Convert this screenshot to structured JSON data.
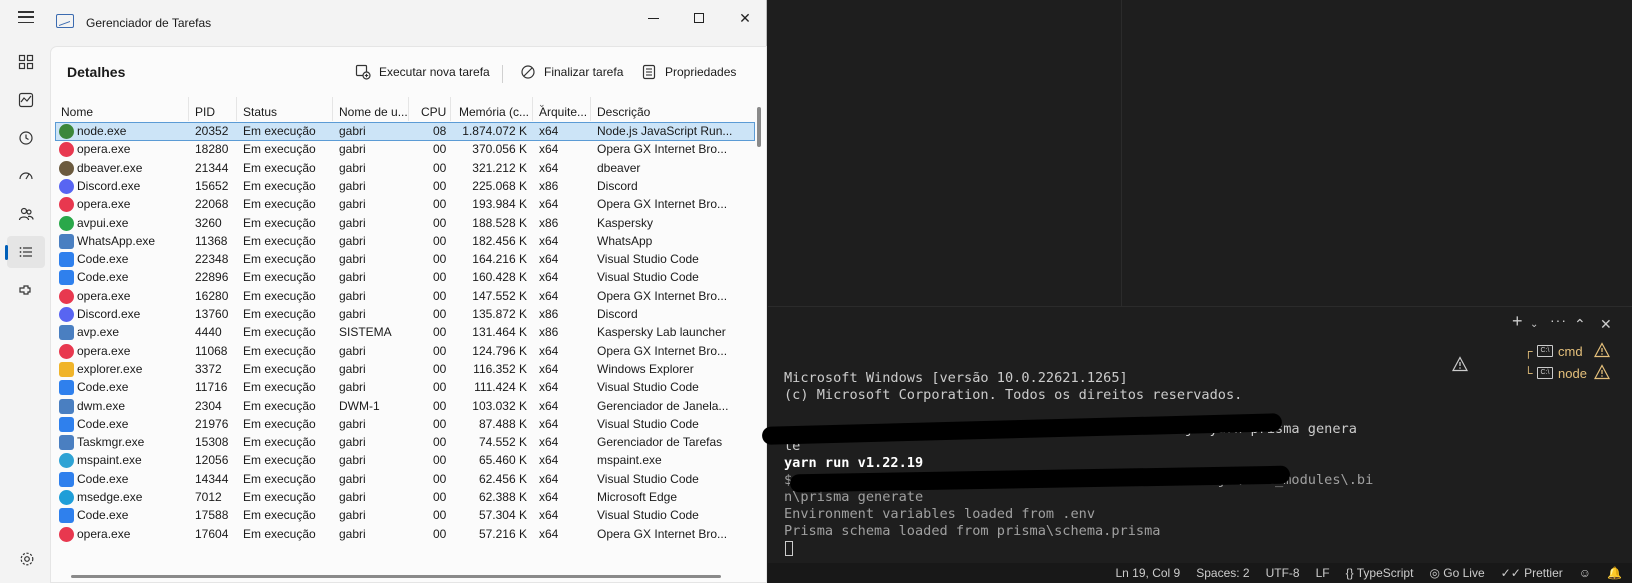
{
  "window": {
    "title": "Gerenciador de Tarefas",
    "minimize": "—",
    "maximize": "☐",
    "close": "✕"
  },
  "nav": {
    "items": [
      "processes-icon",
      "performance-icon",
      "app-history-icon",
      "startup-icon",
      "users-icon",
      "details-icon",
      "services-icon"
    ],
    "active": "details-icon"
  },
  "header": {
    "title": "Detalhes",
    "run_new_task": "Executar nova tarefa",
    "end_task": "Finalizar tarefa",
    "properties": "Propriedades"
  },
  "table": {
    "columns": [
      "Nome",
      "PID",
      "Status",
      "Nome de u...",
      "CPU",
      "Memória (c...",
      "Arquite...",
      "Descrição"
    ],
    "rows": [
      {
        "name": "node.exe",
        "pid": "20352",
        "status": "Em execução",
        "user": "gabri",
        "cpu": "08",
        "mem": "1.874.072 K",
        "arch": "x64",
        "desc": "Node.js JavaScript Run...",
        "icon": "node-icon",
        "color": "#3c873a",
        "selected": true
      },
      {
        "name": "opera.exe",
        "pid": "18280",
        "status": "Em execução",
        "user": "gabri",
        "cpu": "00",
        "mem": "370.056 K",
        "arch": "x64",
        "desc": "Opera GX Internet Bro...",
        "icon": "opera-icon",
        "color": "#e8384f"
      },
      {
        "name": "dbeaver.exe",
        "pid": "21344",
        "status": "Em execução",
        "user": "gabri",
        "cpu": "00",
        "mem": "321.212 K",
        "arch": "x64",
        "desc": "dbeaver",
        "icon": "dbeaver-icon",
        "color": "#6b5a3e"
      },
      {
        "name": "Discord.exe",
        "pid": "15652",
        "status": "Em execução",
        "user": "gabri",
        "cpu": "00",
        "mem": "225.068 K",
        "arch": "x86",
        "desc": "Discord",
        "icon": "discord-icon",
        "color": "#5865f2"
      },
      {
        "name": "opera.exe",
        "pid": "22068",
        "status": "Em execução",
        "user": "gabri",
        "cpu": "00",
        "mem": "193.984 K",
        "arch": "x64",
        "desc": "Opera GX Internet Bro...",
        "icon": "opera-icon",
        "color": "#e8384f"
      },
      {
        "name": "avpui.exe",
        "pid": "3260",
        "status": "Em execução",
        "user": "gabri",
        "cpu": "00",
        "mem": "188.528 K",
        "arch": "x86",
        "desc": "Kaspersky",
        "icon": "kaspersky-icon",
        "color": "#2aa84a"
      },
      {
        "name": "WhatsApp.exe",
        "pid": "11368",
        "status": "Em execução",
        "user": "gabri",
        "cpu": "00",
        "mem": "182.456 K",
        "arch": "x64",
        "desc": "WhatsApp",
        "icon": "whatsapp-icon",
        "color": "#4a7fc1"
      },
      {
        "name": "Code.exe",
        "pid": "22348",
        "status": "Em execução",
        "user": "gabri",
        "cpu": "00",
        "mem": "164.216 K",
        "arch": "x64",
        "desc": "Visual Studio Code",
        "icon": "vscode-icon",
        "color": "#2f80ed"
      },
      {
        "name": "Code.exe",
        "pid": "22896",
        "status": "Em execução",
        "user": "gabri",
        "cpu": "00",
        "mem": "160.428 K",
        "arch": "x64",
        "desc": "Visual Studio Code",
        "icon": "vscode-icon",
        "color": "#2f80ed"
      },
      {
        "name": "opera.exe",
        "pid": "16280",
        "status": "Em execução",
        "user": "gabri",
        "cpu": "00",
        "mem": "147.552 K",
        "arch": "x64",
        "desc": "Opera GX Internet Bro...",
        "icon": "opera-icon",
        "color": "#e8384f"
      },
      {
        "name": "Discord.exe",
        "pid": "13760",
        "status": "Em execução",
        "user": "gabri",
        "cpu": "00",
        "mem": "135.872 K",
        "arch": "x86",
        "desc": "Discord",
        "icon": "discord-icon",
        "color": "#5865f2"
      },
      {
        "name": "avp.exe",
        "pid": "4440",
        "status": "Em execução",
        "user": "SISTEMA",
        "cpu": "00",
        "mem": "131.464 K",
        "arch": "x86",
        "desc": "Kaspersky Lab launcher",
        "icon": "app-window-icon",
        "color": "#4a7fc1"
      },
      {
        "name": "opera.exe",
        "pid": "11068",
        "status": "Em execução",
        "user": "gabri",
        "cpu": "00",
        "mem": "124.796 K",
        "arch": "x64",
        "desc": "Opera GX Internet Bro...",
        "icon": "opera-icon",
        "color": "#e8384f"
      },
      {
        "name": "explorer.exe",
        "pid": "3372",
        "status": "Em execução",
        "user": "gabri",
        "cpu": "00",
        "mem": "116.352 K",
        "arch": "x64",
        "desc": "Windows Explorer",
        "icon": "folder-icon",
        "color": "#f0b429"
      },
      {
        "name": "Code.exe",
        "pid": "11716",
        "status": "Em execução",
        "user": "gabri",
        "cpu": "00",
        "mem": "111.424 K",
        "arch": "x64",
        "desc": "Visual Studio Code",
        "icon": "vscode-icon",
        "color": "#2f80ed"
      },
      {
        "name": "dwm.exe",
        "pid": "2304",
        "status": "Em execução",
        "user": "DWM-1",
        "cpu": "00",
        "mem": "103.032 K",
        "arch": "x64",
        "desc": "Gerenciador de Janela...",
        "icon": "app-window-icon",
        "color": "#4a7fc1"
      },
      {
        "name": "Code.exe",
        "pid": "21976",
        "status": "Em execução",
        "user": "gabri",
        "cpu": "00",
        "mem": "87.488 K",
        "arch": "x64",
        "desc": "Visual Studio Code",
        "icon": "vscode-icon",
        "color": "#2f80ed"
      },
      {
        "name": "Taskmgr.exe",
        "pid": "15308",
        "status": "Em execução",
        "user": "gabri",
        "cpu": "00",
        "mem": "74.552 K",
        "arch": "x64",
        "desc": "Gerenciador de Tarefas",
        "icon": "taskmgr-icon",
        "color": "#4a7fc1"
      },
      {
        "name": "mspaint.exe",
        "pid": "12056",
        "status": "Em execução",
        "user": "gabri",
        "cpu": "00",
        "mem": "65.460 K",
        "arch": "x64",
        "desc": "mspaint.exe",
        "icon": "paint-icon",
        "color": "#2fa3d4"
      },
      {
        "name": "Code.exe",
        "pid": "14344",
        "status": "Em execução",
        "user": "gabri",
        "cpu": "00",
        "mem": "62.456 K",
        "arch": "x64",
        "desc": "Visual Studio Code",
        "icon": "vscode-icon",
        "color": "#2f80ed"
      },
      {
        "name": "msedge.exe",
        "pid": "7012",
        "status": "Em execução",
        "user": "gabri",
        "cpu": "00",
        "mem": "62.388 K",
        "arch": "x64",
        "desc": "Microsoft Edge",
        "icon": "edge-icon",
        "color": "#1f9ed8"
      },
      {
        "name": "Code.exe",
        "pid": "17588",
        "status": "Em execução",
        "user": "gabri",
        "cpu": "00",
        "mem": "57.304 K",
        "arch": "x64",
        "desc": "Visual Studio Code",
        "icon": "vscode-icon",
        "color": "#2f80ed"
      },
      {
        "name": "opera.exe",
        "pid": "17604",
        "status": "Em execução",
        "user": "gabri",
        "cpu": "00",
        "mem": "57.216 K",
        "arch": "x64",
        "desc": "Opera GX Internet Bro...",
        "icon": "opera-icon",
        "color": "#e8384f"
      }
    ]
  },
  "terminal": {
    "tabs": [
      {
        "label": "cmd"
      },
      {
        "label": "node"
      }
    ],
    "lines": [
      {
        "text": "Microsoft Windows [versão 10.0.22621.1265]",
        "style": ""
      },
      {
        "text": "(c) Microsoft Corporation. Todos os direitos reservados.",
        "style": ""
      },
      {
        "text": "",
        "style": ""
      },
      {
        "text": "                                             nestjs>yarn prisma genera",
        "style": ""
      },
      {
        "text": "te",
        "style": ""
      },
      {
        "text": "yarn run v1.22.19",
        "style": "bold"
      },
      {
        "text": "$                                                nestjs\\node_modules\\.bi",
        "style": "dim"
      },
      {
        "text": "n\\prisma generate",
        "style": "dim"
      },
      {
        "text": "Environment variables loaded from .env",
        "style": "dim"
      },
      {
        "text": "Prisma schema loaded from prisma\\schema.prisma",
        "style": "dim"
      }
    ]
  },
  "statusbar": {
    "position": "Ln 19, Col 9",
    "spaces": "Spaces: 2",
    "encoding": "UTF-8",
    "eol": "LF",
    "language": "TypeScript",
    "golive": "Go Live",
    "prettier": "Prettier"
  }
}
